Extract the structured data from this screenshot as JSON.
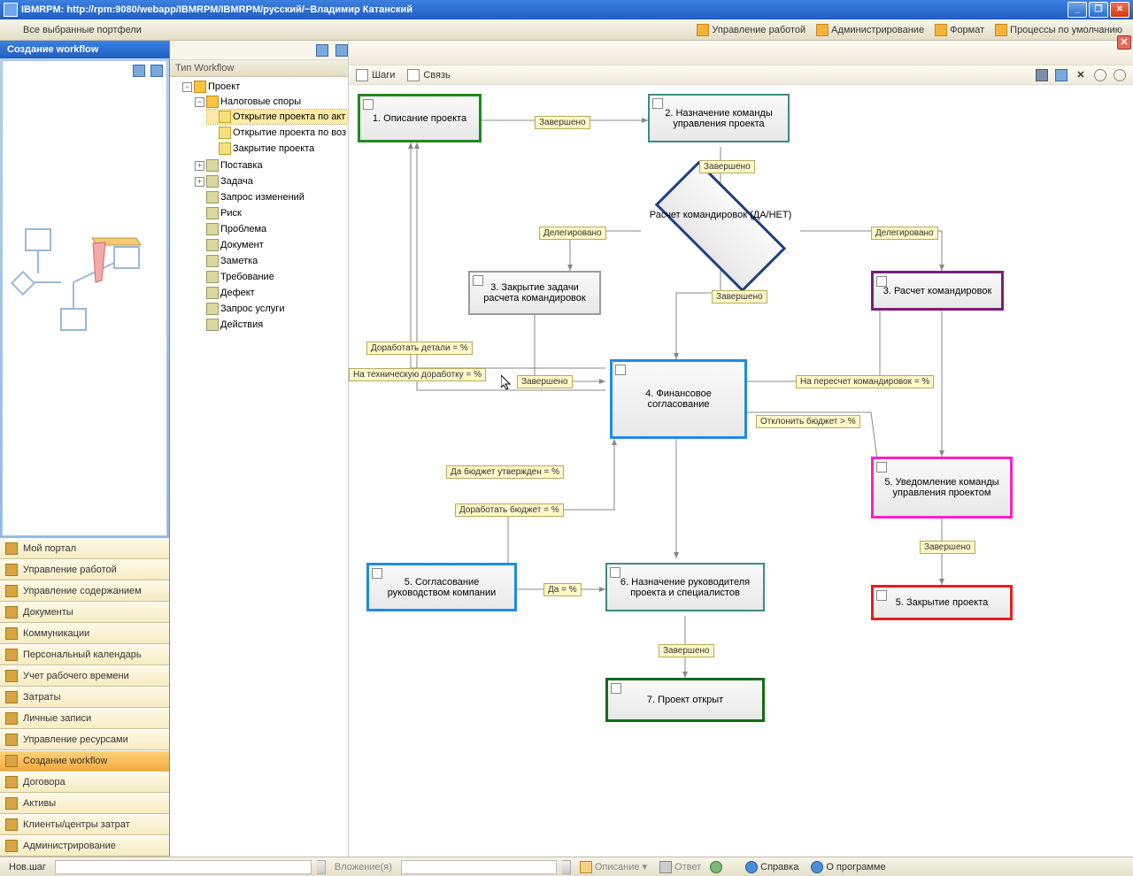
{
  "window": {
    "title": "IBMRPM: http://rpm:9080/webapp/IBMRPM/IBMRPM/русский/~Владимир Катанский"
  },
  "subtoolbar": {
    "portfolio_label": "Все выбранные портфели",
    "links": {
      "work": "Управление работой",
      "admin": "Администрирование",
      "format": "Формат",
      "processes": "Процессы по умолчанию"
    }
  },
  "leftnav": {
    "header": "Создание workflow",
    "items": [
      "Мой портал",
      "Управление работой",
      "Управление содержанием",
      "Документы",
      "Коммуникации",
      "Персональный календарь",
      "Учет рабочего времени",
      "Затраты",
      "Личные записи",
      "Управление ресурсами",
      "Создание workflow",
      "Договора",
      "Активы",
      "Клиенты/центры затрат",
      "Администрирование"
    ],
    "active_index": 10
  },
  "tree": {
    "header": "Тип Workflow",
    "root": "Проект",
    "tax": "Налоговые споры",
    "tax_children": [
      "Открытие проекта по акт",
      "Открытие проекта по воз",
      "Закрытие проекта"
    ],
    "siblings": [
      "Поставка",
      "Задача",
      "Запрос изменений",
      "Риск",
      "Проблема",
      "Документ",
      "Заметка",
      "Требование",
      "Дефект",
      "Запрос услуги",
      "Действия"
    ]
  },
  "canvas": {
    "toolbar": {
      "steps": "Шаги",
      "link": "Связь"
    },
    "nodes": {
      "n1": "1. Описание проекта",
      "n2": "2. Назначение команды управления проекта",
      "dec": "Расчет командировок (ДА/НЕТ)",
      "n3a": "3. Закрытие задачи расчета командировок",
      "n3b": "3. Расчет командировок",
      "n4": "4. Финансовое согласование",
      "n5a": "5. Согласование руководством компании",
      "n5b": "5. Уведомление команды управления проектом",
      "n5c": "5. Закрытие проекта",
      "n6": "6. Назначение руководителя проекта и специалистов",
      "n7": "7. Проект открыт"
    },
    "labels": {
      "done": "Завершено",
      "delegated": "Делегировано",
      "details": "Доработать детали = %",
      "technical": "На техническую доработку = %",
      "recalc": "На пересчет командировок = %",
      "reject": "Отклонить бюджет > %",
      "budget_yes": "Да бюджет утвержден = %",
      "budget_rework": "Доработать бюджет = %",
      "yes": "Да = %"
    }
  },
  "statusbar": {
    "newstep": "Нов.шаг",
    "attachments": "Вложение(я)",
    "description": "Описание",
    "reply": "Ответ",
    "help": "Справка",
    "about": "О программе"
  }
}
